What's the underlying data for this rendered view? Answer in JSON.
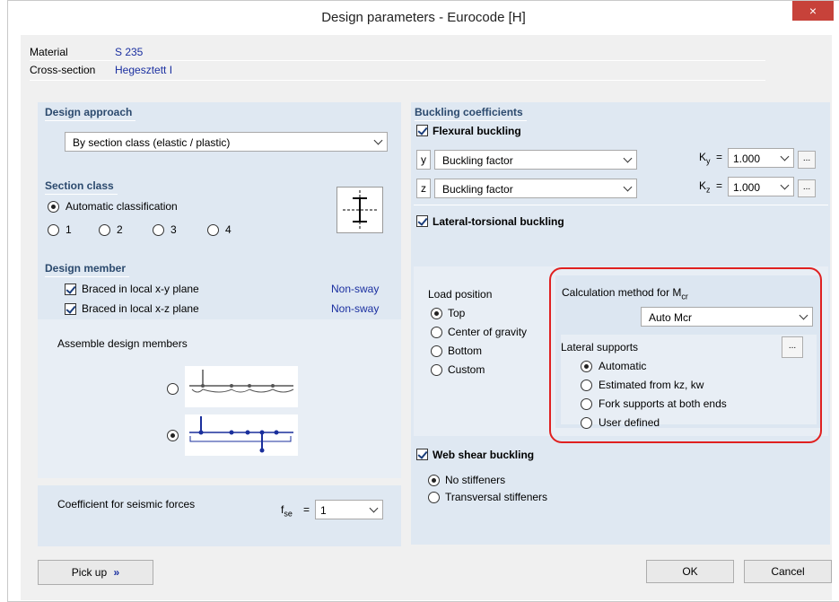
{
  "window": {
    "title": "Design parameters - Eurocode [H]"
  },
  "header": {
    "material_label": "Material",
    "material_value": "S 235",
    "cross_label": "Cross-section",
    "cross_value": "Hegesztett I"
  },
  "design_approach": {
    "title": "Design approach",
    "value": "By section class (elastic / plastic)"
  },
  "section_class": {
    "title": "Section class",
    "auto": "Automatic classification",
    "opt1": "1",
    "opt2": "2",
    "opt3": "3",
    "opt4": "4"
  },
  "design_member": {
    "title": "Design member",
    "xy_label": "Braced in local x-y plane",
    "xy_value": "Non-sway",
    "xz_label": "Braced in local x-z plane",
    "xz_value": "Non-sway",
    "assemble": "Assemble design members"
  },
  "seismic": {
    "label": "Coefficient for seismic forces",
    "fse_main": "f",
    "fse_sub": "se",
    "eq": "=",
    "value": "1"
  },
  "buckling": {
    "title": "Buckling coefficients",
    "flexural": "Flexural buckling",
    "y_axis": "y",
    "y_value": "Buckling factor",
    "ky_main": "K",
    "ky_sub": "y",
    "ky_value": "1.000",
    "z_axis": "z",
    "z_value": "Buckling factor",
    "kz_main": "K",
    "kz_sub": "z",
    "kz_value": "1.000",
    "eq": "=",
    "dots": "...",
    "lateral": "Lateral-torsional buckling"
  },
  "load_position": {
    "title": "Load position",
    "top": "Top",
    "center": "Center of gravity",
    "bottom": "Bottom",
    "custom": "Custom"
  },
  "calc": {
    "title_main": "Calculation method for M",
    "title_sub": "cr",
    "value": "Auto Mcr"
  },
  "supports": {
    "title": "Lateral supports",
    "dots": "...",
    "automatic": "Automatic",
    "estimated": "Estimated from kz, kw",
    "fork": "Fork supports at both ends",
    "user": "User defined"
  },
  "web": {
    "title": "Web shear buckling",
    "no": "No stiffeners",
    "trans": "Transversal stiffeners"
  },
  "footer": {
    "pickup": "Pick up",
    "pickup_icon": "»",
    "ok": "OK",
    "cancel": "Cancel"
  },
  "icons": {
    "close": "×"
  },
  "colors": {
    "accent": "#1a2fa0",
    "highlight": "#e02020",
    "close": "#c7423a"
  }
}
